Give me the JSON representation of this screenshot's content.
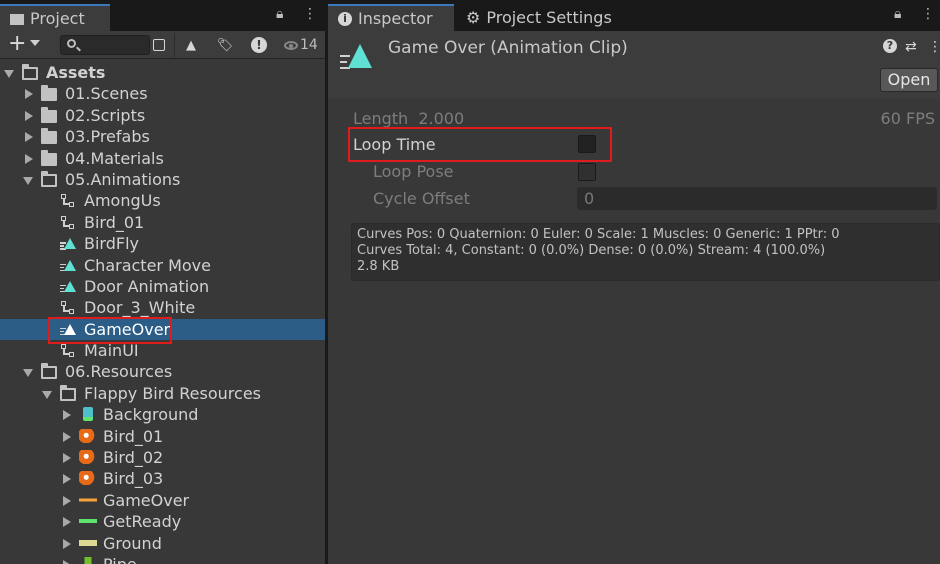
{
  "project_panel": {
    "tab_label": "Project",
    "search": {
      "value": "",
      "placeholder": ""
    },
    "visibility_count": "14",
    "tree": [
      {
        "label": "Assets",
        "kind": "folder-open",
        "depth": 0,
        "expanded": true
      },
      {
        "label": "01.Scenes",
        "kind": "folder",
        "depth": 1
      },
      {
        "label": "02.Scripts",
        "kind": "folder",
        "depth": 1
      },
      {
        "label": "03.Prefabs",
        "kind": "folder",
        "depth": 1
      },
      {
        "label": "04.Materials",
        "kind": "folder",
        "depth": 1
      },
      {
        "label": "05.Animations",
        "kind": "folder-open",
        "depth": 1,
        "expanded": true
      },
      {
        "label": "AmongUs",
        "kind": "controller",
        "depth": 2
      },
      {
        "label": "Bird_01",
        "kind": "controller",
        "depth": 2
      },
      {
        "label": "BirdFly",
        "kind": "animation",
        "depth": 2
      },
      {
        "label": "Character Move",
        "kind": "animation",
        "depth": 2
      },
      {
        "label": "Door Animation",
        "kind": "animation",
        "depth": 2
      },
      {
        "label": "Door_3_White",
        "kind": "controller",
        "depth": 2
      },
      {
        "label": "GameOver",
        "kind": "animation",
        "depth": 2,
        "selected": true
      },
      {
        "label": "MainUI",
        "kind": "controller",
        "depth": 2
      },
      {
        "label": "06.Resources",
        "kind": "folder-open",
        "depth": 1,
        "expanded": true
      },
      {
        "label": "Flappy Bird Resources",
        "kind": "folder-open",
        "depth": 2,
        "expanded": true
      },
      {
        "label": "Background",
        "kind": "sprite-bg",
        "depth": 3
      },
      {
        "label": "Bird_01",
        "kind": "sprite-bird",
        "depth": 3
      },
      {
        "label": "Bird_02",
        "kind": "sprite-bird",
        "depth": 3
      },
      {
        "label": "Bird_03",
        "kind": "sprite-bird",
        "depth": 3
      },
      {
        "label": "GameOver",
        "kind": "sprite-gameover",
        "depth": 3
      },
      {
        "label": "GetReady",
        "kind": "sprite-getready",
        "depth": 3
      },
      {
        "label": "Ground",
        "kind": "sprite-ground",
        "depth": 3
      },
      {
        "label": "Pipe",
        "kind": "sprite-pipe",
        "depth": 3
      }
    ]
  },
  "inspector": {
    "tabs": [
      {
        "label": "Inspector",
        "icon": "info-icon",
        "active": true
      },
      {
        "label": "Project Settings",
        "icon": "gear-icon",
        "active": false
      }
    ],
    "title": "Game Over (Animation Clip)",
    "open_label": "Open",
    "length_label": "Length",
    "length_value": "2.000",
    "fps_label": "60 FPS",
    "loop_time_label": "Loop Time",
    "loop_pose_label": "Loop Pose",
    "cycle_offset_label": "Cycle Offset",
    "cycle_offset_value": "0",
    "info_lines": [
      "Curves Pos: 0 Quaternion: 0 Euler: 0 Scale: 1 Muscles: 0 Generic: 1 PPtr: 0",
      "Curves Total: 4, Constant: 0 (0.0%) Dense: 0 (0.0%) Stream: 4 (100.0%)",
      "2.8 KB"
    ]
  },
  "colors": {
    "selection": "#2c5d87",
    "highlight_box": "#e01b1b",
    "anim_accent": "#5ee0d2"
  }
}
